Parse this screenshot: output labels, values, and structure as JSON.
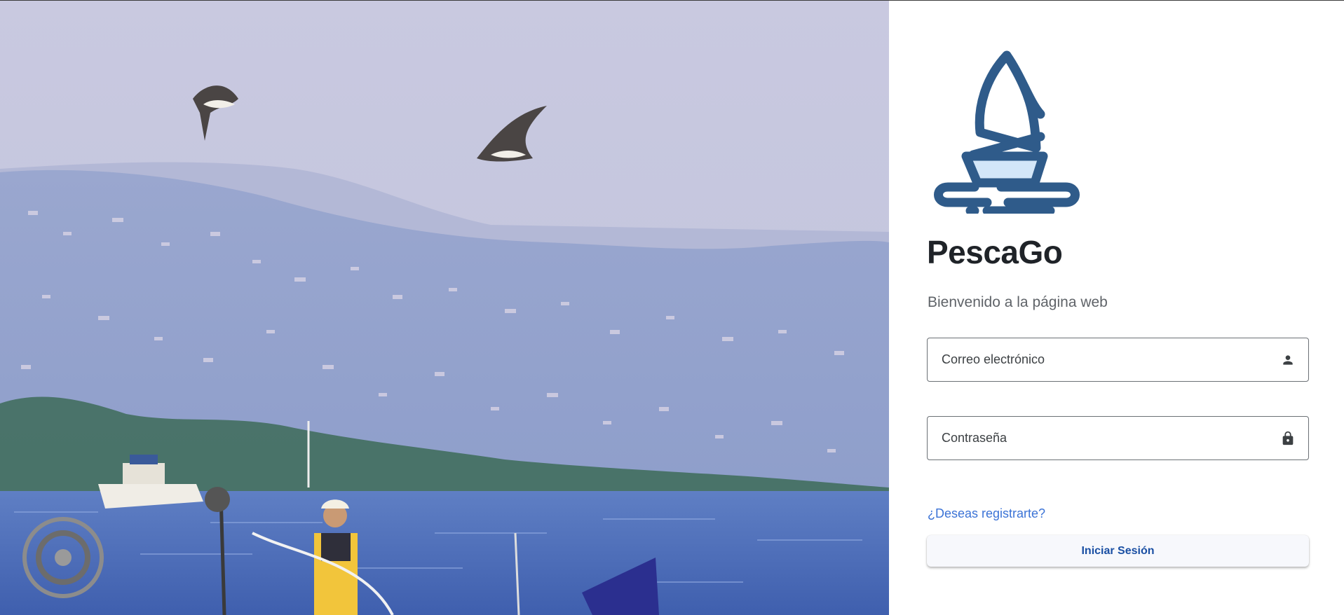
{
  "brand": {
    "name": "PescaGo",
    "tagline": "Bienvenido a la página web",
    "logo_icon": "sailboat-logo-icon",
    "logo_color": "#2f5b8a",
    "logo_fill": "#d3e6f8"
  },
  "login_form": {
    "email_placeholder": "Correo electrónico",
    "email_icon": "person-icon",
    "password_placeholder": "Contraseña",
    "password_icon": "lock-icon",
    "register_link": "¿Deseas registrarte?",
    "submit_label": "Iniciar Sesión"
  },
  "hero": {
    "image_icon": "coastal-fishing-photo"
  },
  "colors": {
    "link": "#3b73d6",
    "button_text": "#1a4fa3",
    "title": "#1f2328"
  }
}
